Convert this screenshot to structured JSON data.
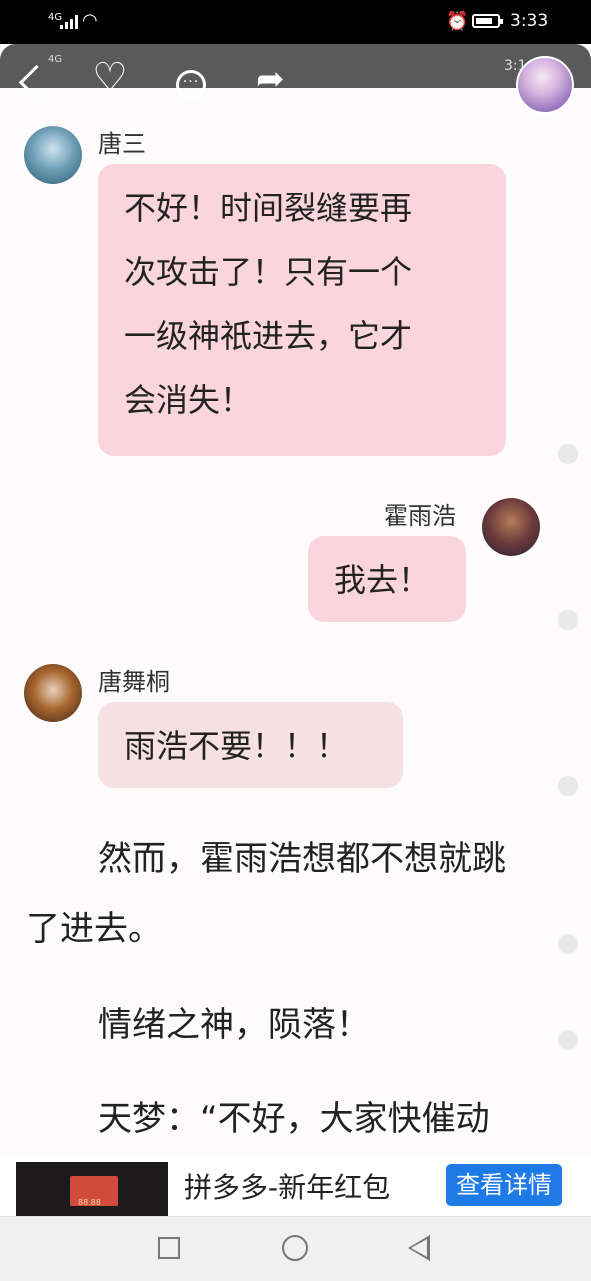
{
  "status_bar": {
    "network": "4G",
    "time": "3:33"
  },
  "top_bar": {
    "ghost_network": "4G",
    "ghost_time": "3:1"
  },
  "messages": [
    {
      "sender": "唐三",
      "lines": [
        "不好！时间裂缝要再",
        "次攻击了！只有一个",
        "一级神祇进去，它才",
        "会消失！"
      ]
    },
    {
      "sender": "霍雨浩",
      "lines": [
        "我去！"
      ]
    },
    {
      "sender": "唐舞桐",
      "lines": [
        "雨浩不要！！！"
      ]
    }
  ],
  "paragraphs": [
    "然而，霍雨浩想都不想就跳",
    "了进去。",
    "情绪之神，陨落！",
    "天梦：“不好，大家快催动"
  ],
  "ad": {
    "title": "拼多多-新年红包",
    "button": "查看详情",
    "thumb_value": "88.88"
  }
}
